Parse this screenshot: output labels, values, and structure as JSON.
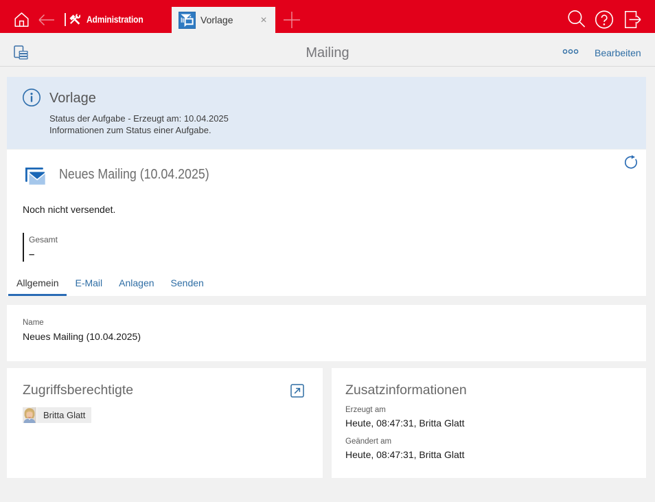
{
  "topbar": {
    "app_name": "Administration",
    "tab": {
      "label": "Vorlage",
      "close_label": "×"
    },
    "icons": {
      "home": "home-icon",
      "back": "back-icon",
      "tools": "tools-icon",
      "new_tab": "plus-icon",
      "search": "search-icon",
      "help": "help-icon",
      "logout": "logout-icon"
    },
    "colors": {
      "bar": "#e2001a",
      "tab_bg": "#f2f2f2"
    }
  },
  "toolbar": {
    "title": "Mailing",
    "edit_label": "Bearbeiten",
    "icons": {
      "copy": "copy-icon",
      "more": "more-icon"
    },
    "accent": "#2e6da4"
  },
  "info_panel": {
    "heading": "Vorlage",
    "line1": "Status der Aufgabe - Erzeugt am: 10.04.2025",
    "line2": "Informationen zum Status einer Aufgabe.",
    "bg": "#e1eaf5"
  },
  "mailing": {
    "heading": "Neues Mailing (10.04.2025)",
    "status": "Noch nicht versendet.",
    "gesamt_label": "Gesamt",
    "gesamt_value": "–",
    "tabs": [
      {
        "label": "Allgemein",
        "active": true
      },
      {
        "label": "E-Mail",
        "active": false
      },
      {
        "label": "Anlagen",
        "active": false
      },
      {
        "label": "Senden",
        "active": false
      }
    ]
  },
  "name_card": {
    "label": "Name",
    "value": "Neues Mailing (10.04.2025)"
  },
  "access_card": {
    "heading": "Zugriffsberechtigte",
    "person": "Britta Glatt"
  },
  "extra_card": {
    "heading": "Zusatzinformationen",
    "created_label": "Erzeugt am",
    "created_value": "Heute, 08:47:31, Britta Glatt",
    "modified_label": "Geändert am",
    "modified_value": "Heute, 08:47:31, Britta Glatt"
  }
}
